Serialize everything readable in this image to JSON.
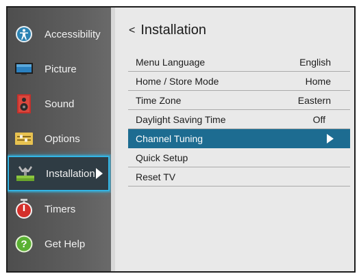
{
  "sidebar": {
    "items": [
      {
        "label": "Accessibility",
        "icon": "accessibility-icon"
      },
      {
        "label": "Picture",
        "icon": "monitor-icon"
      },
      {
        "label": "Sound",
        "icon": "speaker-icon"
      },
      {
        "label": "Options",
        "icon": "options-icon"
      },
      {
        "label": "Installation",
        "icon": "installation-icon",
        "active": true
      },
      {
        "label": "Timers",
        "icon": "timer-icon"
      },
      {
        "label": "Get Help",
        "icon": "help-icon"
      }
    ]
  },
  "panel": {
    "back_symbol": "<",
    "title": "Installation",
    "rows": [
      {
        "label": "Menu Language",
        "value": "English"
      },
      {
        "label": "Home / Store Mode",
        "value": "Home"
      },
      {
        "label": "Time Zone",
        "value": "Eastern"
      },
      {
        "label": "Daylight Saving Time",
        "value": "Off"
      },
      {
        "label": "Channel Tuning",
        "value": "",
        "selected": true
      },
      {
        "label": "Quick Setup",
        "value": ""
      },
      {
        "label": "Reset TV",
        "value": ""
      }
    ]
  },
  "colors": {
    "selection": "#1d6c91",
    "focus_border": "#33b6e6",
    "sidebar": "#5a5a5a"
  }
}
